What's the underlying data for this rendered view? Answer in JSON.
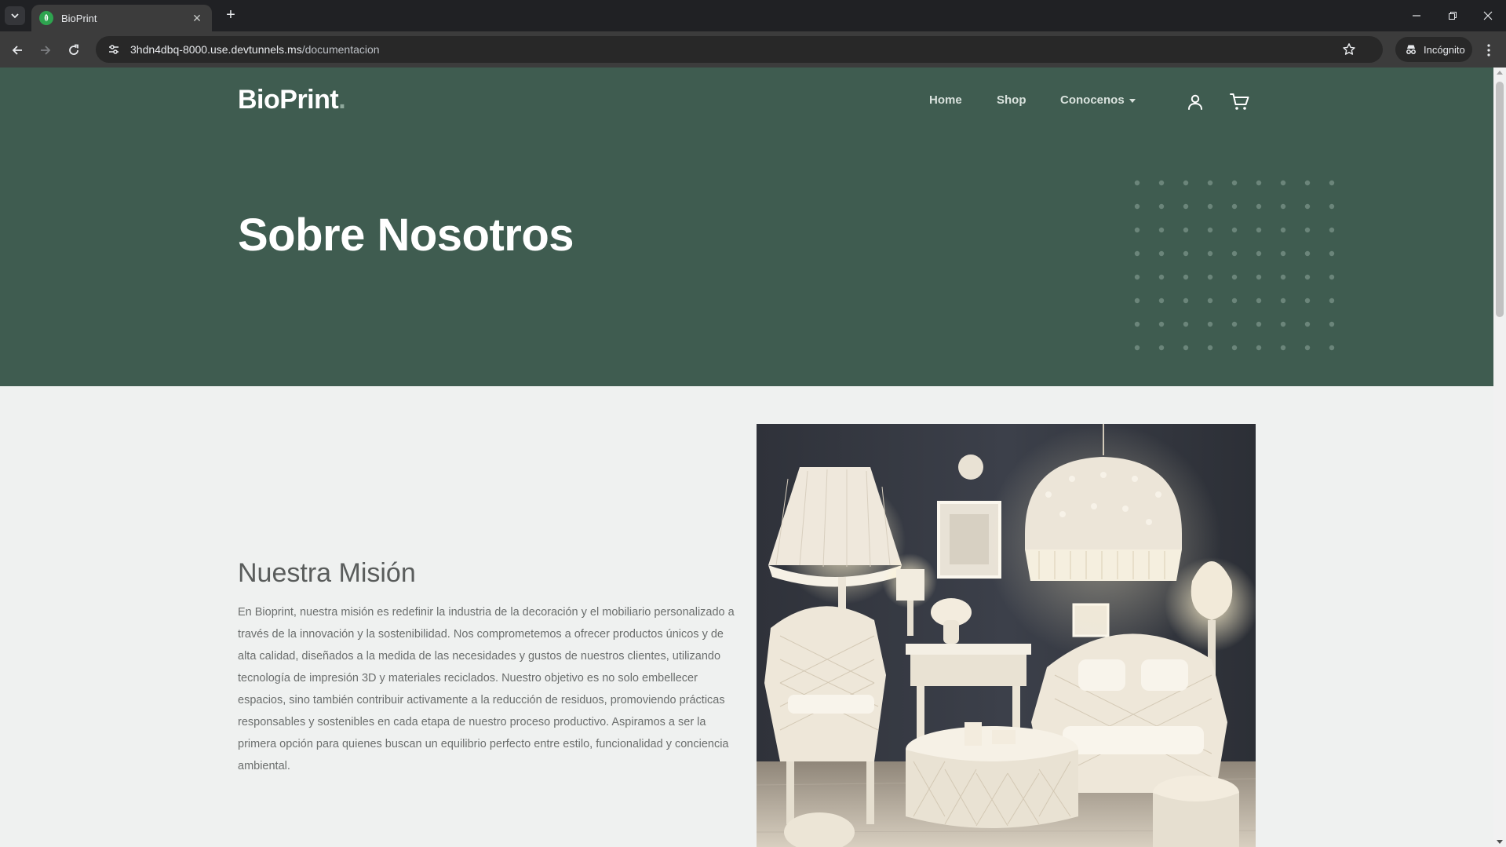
{
  "browser": {
    "tab_title": "BioPrint",
    "url_host": "3hdn4dbq-8000.use.devtunnels.ms",
    "url_path": "/documentacion",
    "incognito_label": "Incógnito",
    "tab_close_glyph": "✕",
    "new_tab_glyph": "+",
    "minimize_glyph": "—",
    "restore_glyph": "❐",
    "close_glyph": "✕"
  },
  "header": {
    "logo": "BioPrint",
    "logo_dot": ".",
    "nav": {
      "home": "Home",
      "shop": "Shop",
      "about": "Conocenos"
    }
  },
  "hero": {
    "title": "Sobre Nosotros"
  },
  "mission": {
    "title": "Nuestra Misión",
    "body": "En Bioprint, nuestra misión es redefinir la industria de la decoración y el mobiliario personalizado a través de la innovación y la sostenibilidad. Nos comprometemos a ofrecer productos únicos y de alta calidad, diseñados a la medida de las necesidades y gustos de nuestros clientes, utilizando tecnología de impresión 3D y materiales reciclados. Nuestro objetivo es no solo embellecer espacios, sino también contribuir activamente a la reducción de residuos, promoviendo prácticas responsables y sostenibles en cada etapa de nuestro proceso productivo. Aspiramos a ser la primera opción para quienes buscan un equilibrio perfecto entre estilo, funcionalidad y conciencia ambiental."
  },
  "colors": {
    "hero_bg": "#3f5c50",
    "page_bg": "#eff1f0",
    "browser_frame": "#202124",
    "browser_toolbar": "#3c3c3c"
  },
  "icons": {
    "tab_search": "chevron-down-icon",
    "favicon": "leaf-icon",
    "back": "arrow-left-icon",
    "forward": "arrow-right-icon",
    "reload": "reload-icon",
    "site_info": "tune-icon",
    "bookmark": "star-icon",
    "incognito": "incognito-icon",
    "menu": "kebab-icon",
    "account": "user-icon",
    "cart": "cart-icon"
  }
}
